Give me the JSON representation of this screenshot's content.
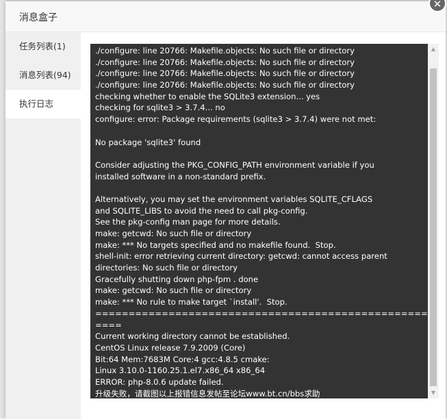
{
  "modal": {
    "title": "消息盒子",
    "close_symbol": "✕"
  },
  "sidebar": {
    "items": [
      {
        "label": "任务列表(1)"
      },
      {
        "label": "消息列表(94)"
      },
      {
        "label": "执行日志"
      }
    ]
  },
  "terminal": {
    "lines": [
      "./configure: line 20766: Makefile.objects: No such file or directory",
      "./configure: line 20766: Makefile.objects: No such file or directory",
      "./configure: line 20766: Makefile.objects: No such file or directory",
      "./configure: line 20766: Makefile.objects: No such file or directory",
      "checking whether to enable the SQLite3 extension... yes",
      "checking for sqlite3 > 3.7.4... no",
      "configure: error: Package requirements (sqlite3 > 3.7.4) were not met:",
      "",
      "No package 'sqlite3' found",
      "",
      "Consider adjusting the PKG_CONFIG_PATH environment variable if you",
      "installed software in a non-standard prefix.",
      "",
      "Alternatively, you may set the environment variables SQLITE_CFLAGS",
      "and SQLITE_LIBS to avoid the need to call pkg-config.",
      "See the pkg-config man page for more details.",
      "make: getcwd: No such file or directory",
      "make: *** No targets specified and no makefile found.  Stop.",
      "shell-init: error retrieving current directory: getcwd: cannot access parent",
      "directories: No such file or directory",
      "Gracefully shutting down php-fpm . done",
      "make: getcwd: No such file or directory",
      "make: *** No rule to make target `install'.  Stop.",
      "====================================================",
      "====",
      "Current working directory cannot be established.",
      "CentOS Linux release 7.9.2009 (Core)",
      "Bit:64 Mem:7683M Core:4 gcc:4.8.5 cmake:",
      "Linux 3.10.0-1160.25.1.el7.x86_64 x86_64",
      "ERROR: php-8.0.6 update failed.",
      "升级失败，请截图以上报错信息发帖至论坛www.bt.cn/bbs求助"
    ]
  },
  "icons": {
    "scroll_up": "scroll-up-arrow-icon",
    "scroll_down": "scroll-down-arrow-icon",
    "close": "close-icon"
  }
}
